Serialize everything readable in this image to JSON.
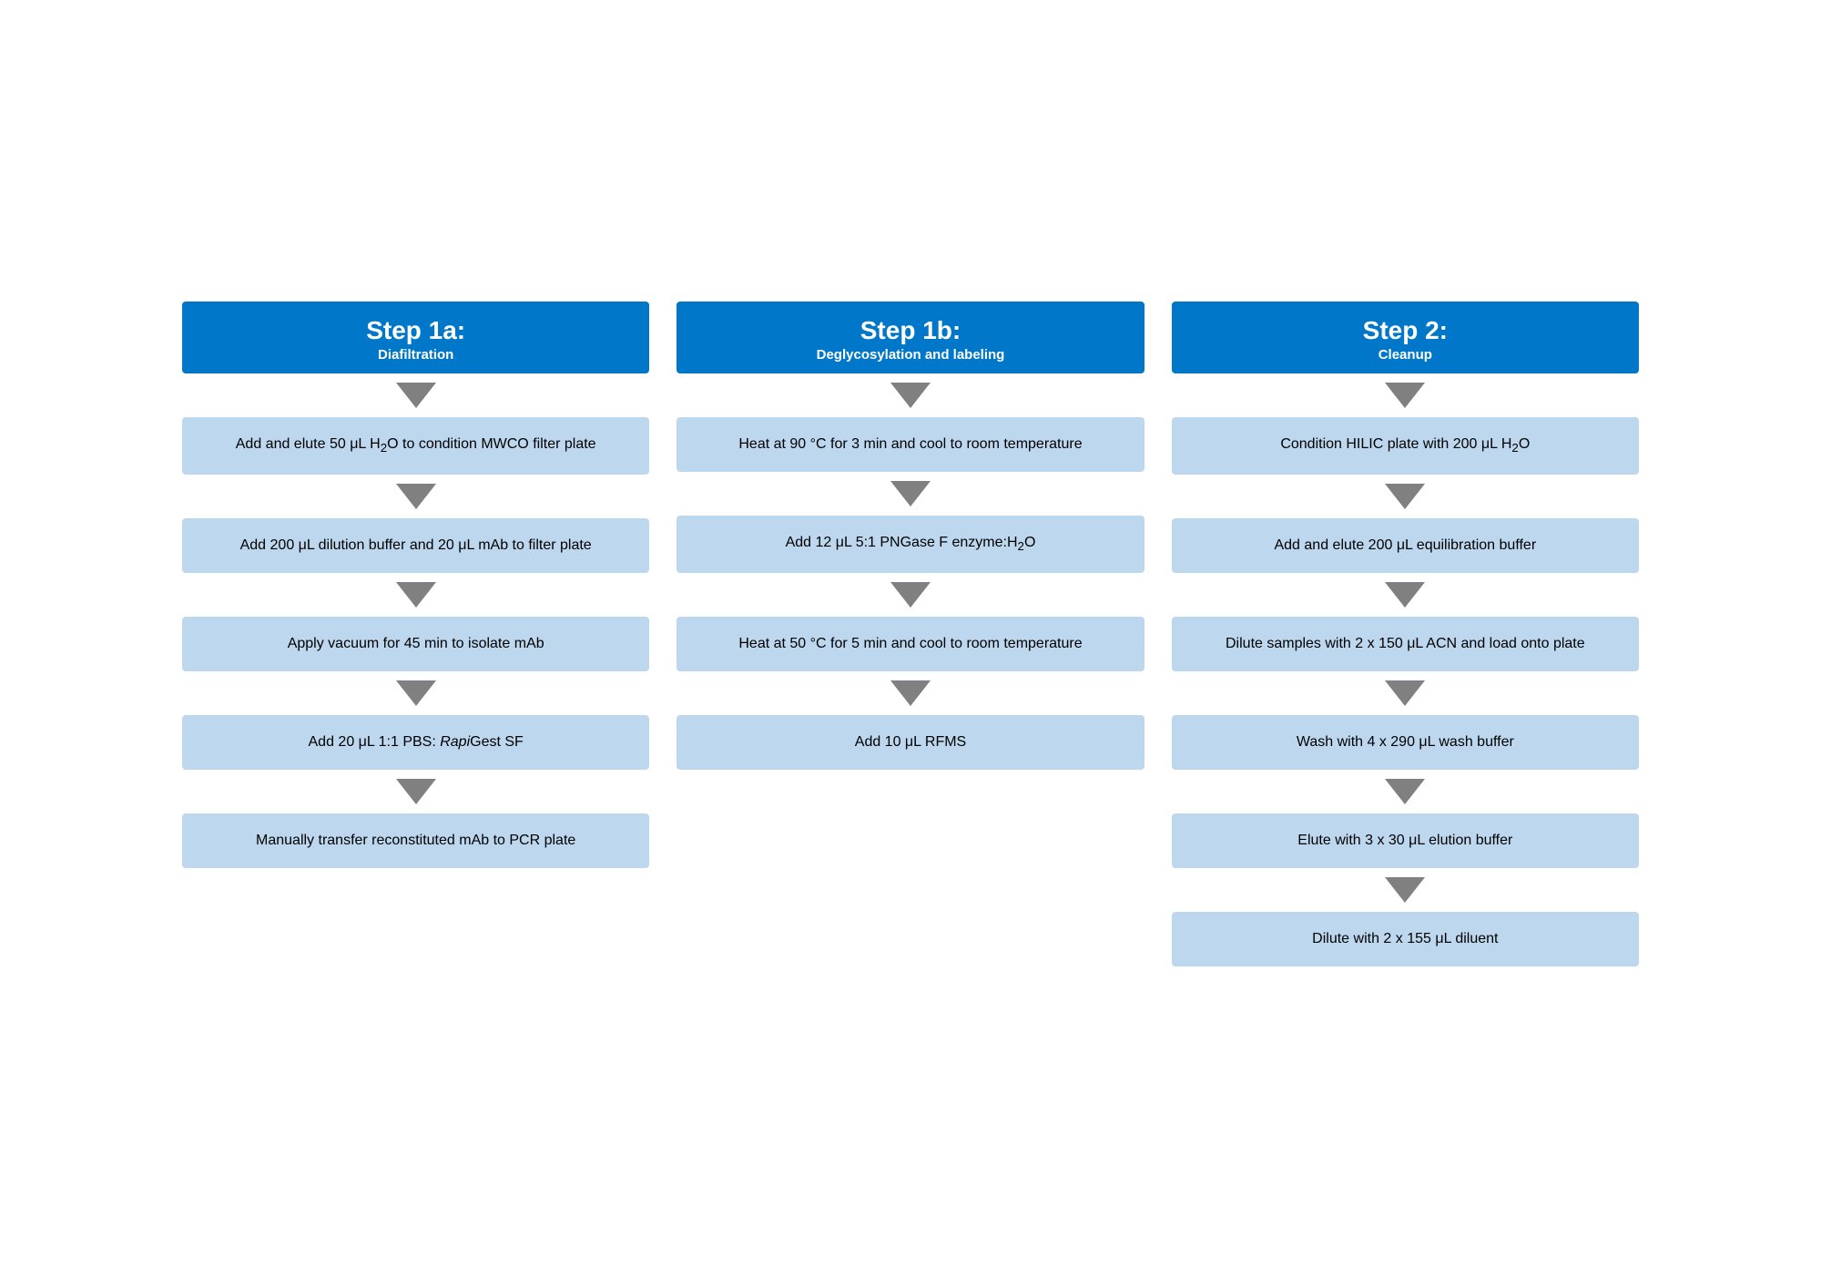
{
  "columns": [
    {
      "id": "step1a",
      "header": {
        "title": "Step 1a:",
        "subtitle": "Diafiltration"
      },
      "boxes": [
        "Add and elute 50 μL H₂O to condition MWCO filter plate",
        "Add 200 μL dilution buffer and 20 μL mAb to filter plate",
        "Apply vacuum for 45 min to isolate mAb",
        "Add 20 μL 1:1 PBS: RapiGest SF",
        "Manually transfer reconstituted mAb to PCR plate"
      ],
      "italic_parts": [
        null,
        null,
        null,
        "Rapi",
        null
      ]
    },
    {
      "id": "step1b",
      "header": {
        "title": "Step 1b:",
        "subtitle": "Deglycosylation and labeling"
      },
      "boxes": [
        "Heat at 90 °C for 3 min and cool to room temperature",
        "Add 12 μL 5:1 PNGase F enzyme:H₂O",
        "Heat at 50 °C for 5 min and cool to room temperature",
        "Add 10 μL RFMS"
      ]
    },
    {
      "id": "step2",
      "header": {
        "title": "Step 2:",
        "subtitle": "Cleanup"
      },
      "boxes": [
        "Condition HILIC plate with 200 μL H₂O",
        "Add and elute 200 μL equilibration buffer",
        "Dilute samples with 2 x 150 μL ACN and load onto plate",
        "Wash with 4 x 290 μL wash buffer",
        "Elute with 3 x 30 μL elution buffer",
        "Dilute with 2 x 155 μL diluent"
      ]
    }
  ]
}
